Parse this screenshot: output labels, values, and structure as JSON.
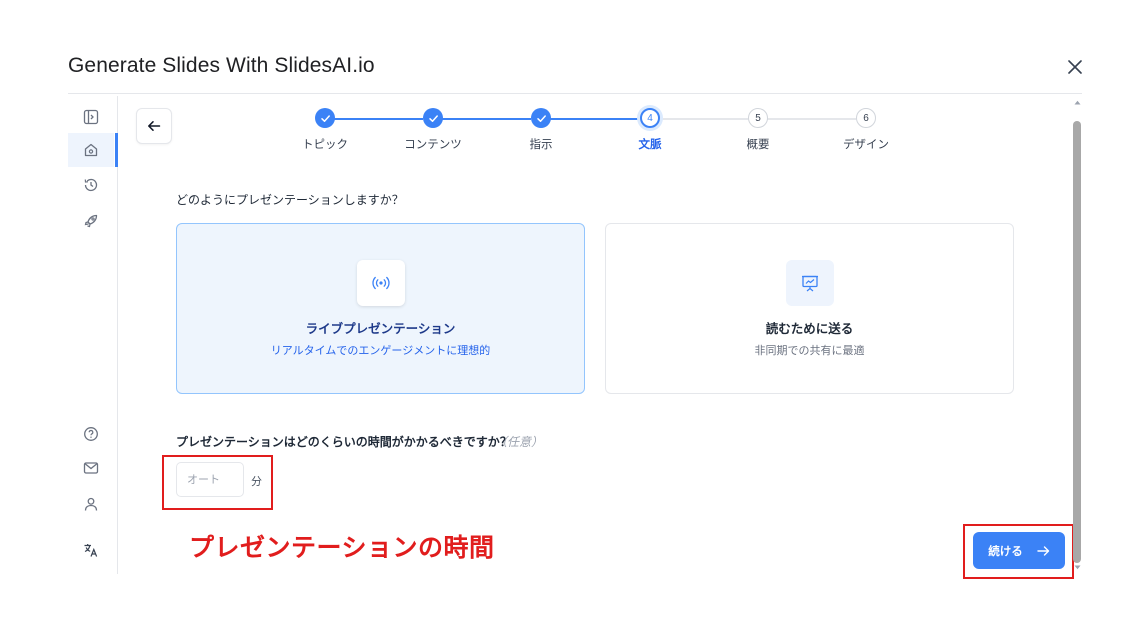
{
  "dialog": {
    "title": "Generate Slides With SlidesAI.io"
  },
  "sidebar": {
    "items": [
      {
        "icon": "panel-toggle-icon"
      },
      {
        "icon": "home-icon",
        "active": true
      },
      {
        "icon": "history-icon"
      },
      {
        "icon": "rocket-icon"
      },
      {
        "icon": "help-icon"
      },
      {
        "icon": "mail-icon"
      },
      {
        "icon": "user-icon"
      },
      {
        "icon": "translate-icon"
      }
    ]
  },
  "stepper": {
    "steps": [
      {
        "number": "1",
        "label": "トピック",
        "state": "done"
      },
      {
        "number": "2",
        "label": "コンテンツ",
        "state": "done"
      },
      {
        "number": "3",
        "label": "指示",
        "state": "done"
      },
      {
        "number": "4",
        "label": "文脈",
        "state": "current"
      },
      {
        "number": "5",
        "label": "概要",
        "state": "todo"
      },
      {
        "number": "6",
        "label": "デザイン",
        "state": "todo"
      }
    ]
  },
  "main": {
    "question1": "どのようにプレゼンテーションしますか？",
    "options": [
      {
        "title": "ライブプレゼンテーション",
        "description": "リアルタイムでのエンゲージメントに理想的",
        "selected": true,
        "icon": "broadcast-icon"
      },
      {
        "title": "読むために送る",
        "description": "非同期での共有に最適",
        "selected": false,
        "icon": "presentation-board-icon"
      }
    ],
    "question2": "プレゼンテーションはどのくらいの時間がかかるべきですか？",
    "optional_label": "（任意）",
    "duration": {
      "placeholder": "オート",
      "value": "",
      "unit": "分"
    },
    "continue_label": "続ける"
  },
  "annotation": {
    "text": "プレゼンテーションの時間",
    "color": "#e11d1d"
  },
  "colors": {
    "accent": "#3b82f6",
    "selected_card_bg": "#eef5fd"
  }
}
